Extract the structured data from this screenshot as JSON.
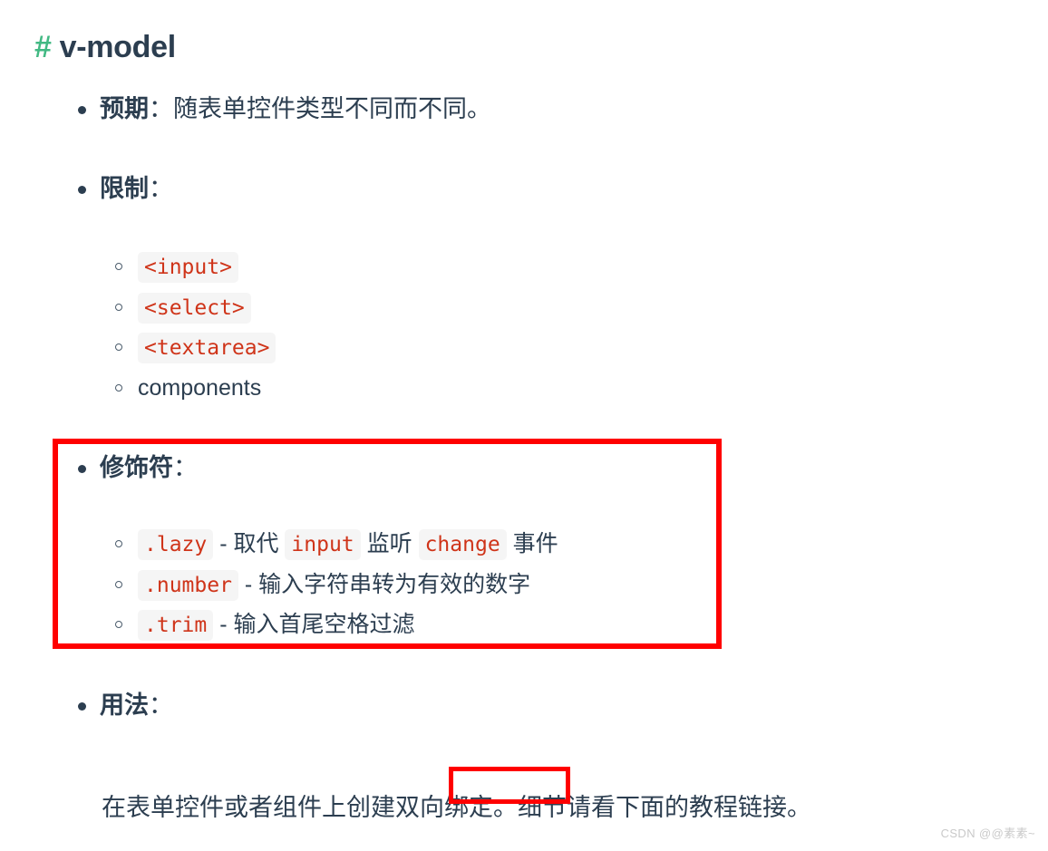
{
  "heading": {
    "anchor": "#",
    "text": "v-model",
    "anchor_color": "#42b983",
    "text_color": "#2c3e50"
  },
  "colors": {
    "code_text": "#cf3419",
    "code_background": "#f5f5f5",
    "annotation_red": "#ff0000",
    "body_text": "#2c3e50"
  },
  "sections": {
    "expect": {
      "label": "预期",
      "separator": "：",
      "description": "随表单控件类型不同而不同。"
    },
    "limit": {
      "label": "限制",
      "separator": "：",
      "items": [
        {
          "text": "<input>",
          "is_code": true
        },
        {
          "text": "<select>",
          "is_code": true
        },
        {
          "text": "<textarea>",
          "is_code": true
        },
        {
          "text": "components",
          "is_code": false
        }
      ]
    },
    "modifiers": {
      "label": "修饰符",
      "separator": "：",
      "items": [
        {
          "parts": [
            {
              "text": ".lazy",
              "is_code": true
            },
            {
              "text": " - 取代 ",
              "is_code": false
            },
            {
              "text": "input",
              "is_code": true
            },
            {
              "text": " 监听 ",
              "is_code": false
            },
            {
              "text": "change",
              "is_code": true
            },
            {
              "text": " 事件",
              "is_code": false
            }
          ]
        },
        {
          "parts": [
            {
              "text": ".number",
              "is_code": true
            },
            {
              "text": " - 输入字符串转为有效的数字",
              "is_code": false
            }
          ]
        },
        {
          "parts": [
            {
              "text": ".trim",
              "is_code": true
            },
            {
              "text": " - 输入首尾空格过滤",
              "is_code": false
            }
          ]
        }
      ]
    },
    "usage": {
      "label": "用法",
      "separator": "：",
      "paragraph": {
        "before": "在表单控件或者组件上创建",
        "highlighted": "双向绑定",
        "after": "。细节请看下面的教程链接。"
      }
    }
  },
  "watermark": "CSDN @@素素~"
}
